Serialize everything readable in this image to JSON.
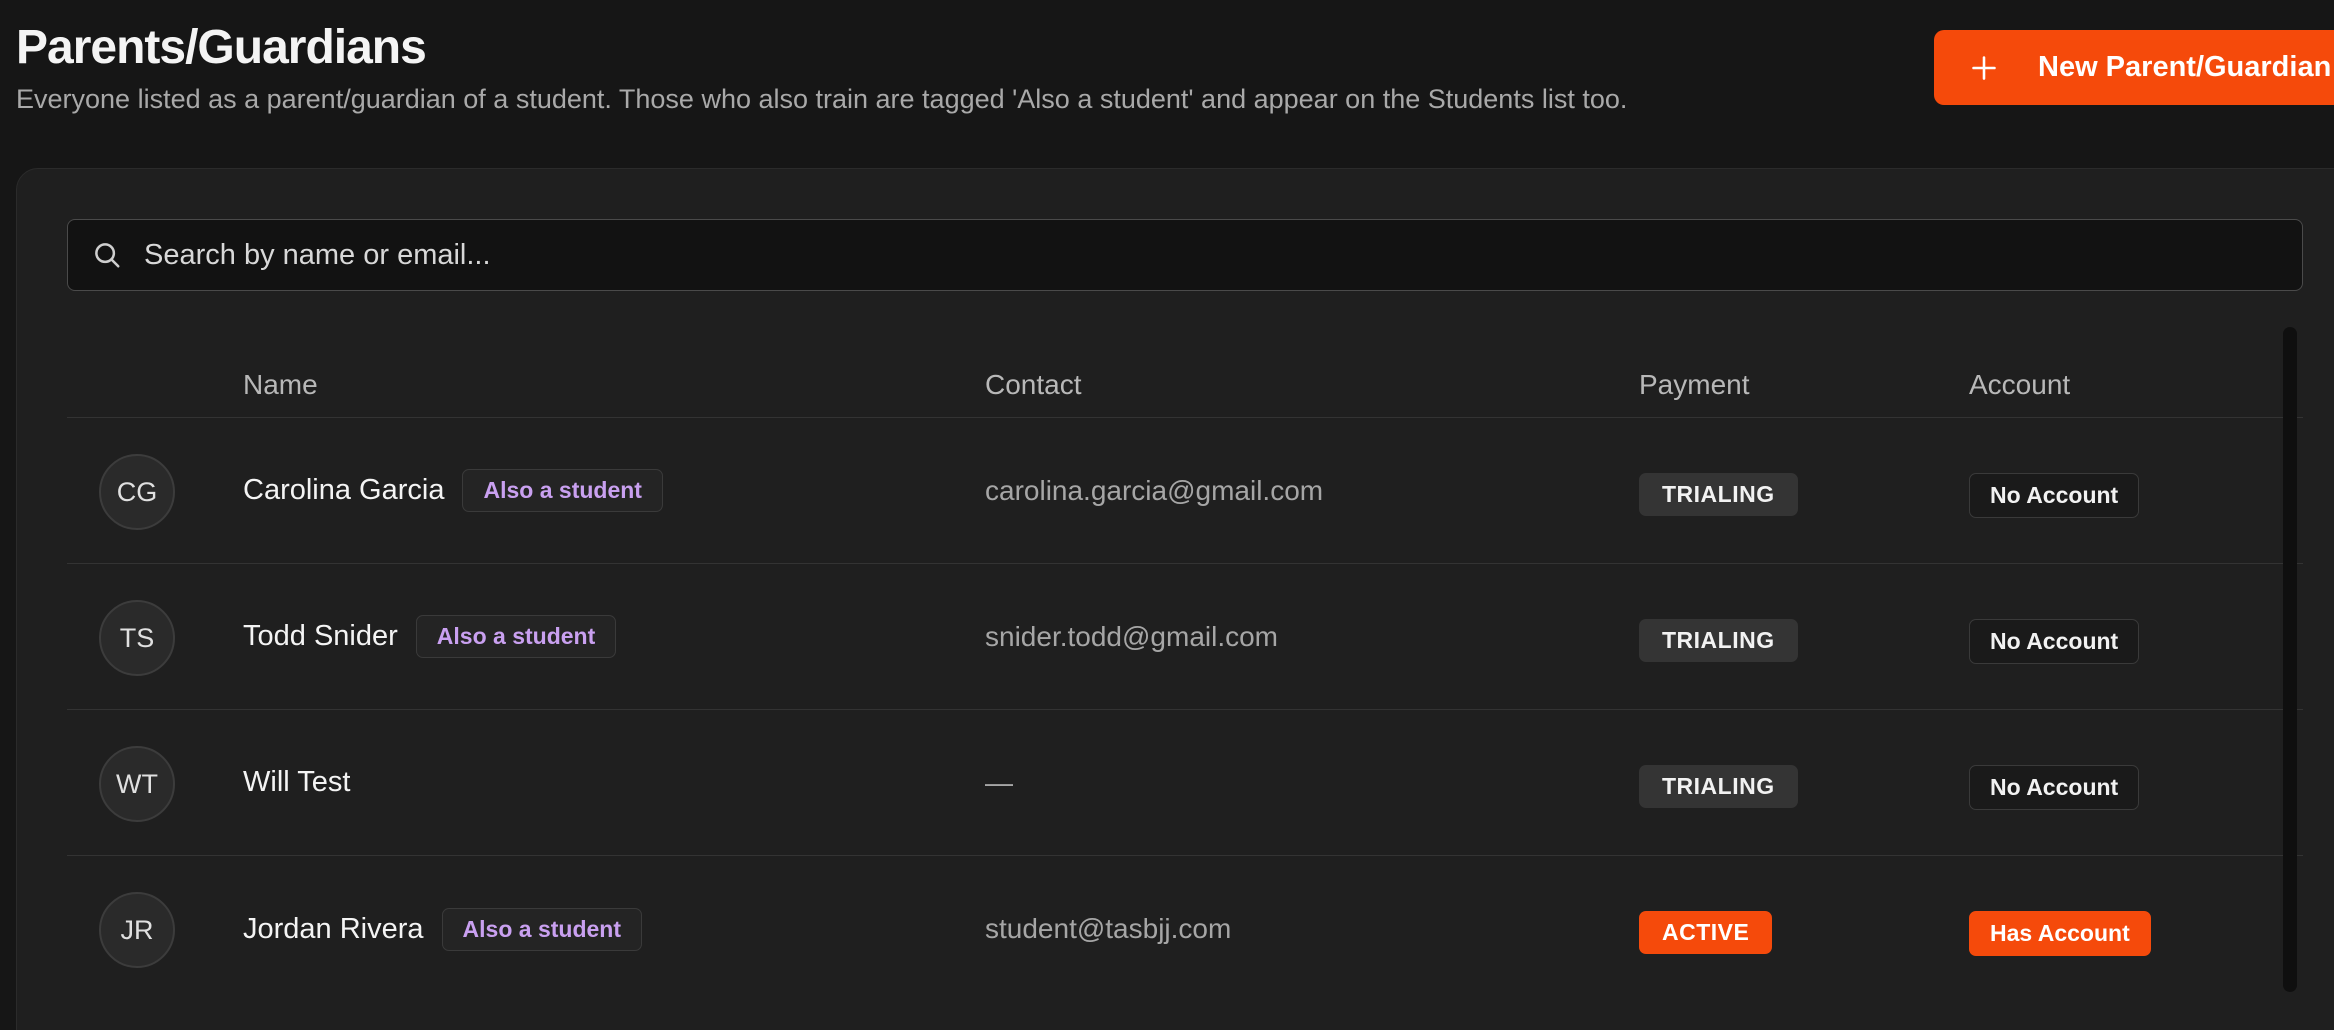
{
  "page": {
    "title": "Parents/Guardians",
    "subtitle": "Everyone listed as a parent/guardian of a student. Those who also train are tagged 'Also a student' and appear on the Students list too.",
    "new_button_label": "New Parent/Guardian",
    "new_button_icon": "plus-icon"
  },
  "colors": {
    "accent": "#f54a0b",
    "tag_text": "#c9a0f0",
    "background": "#161616",
    "card": "#1f1f1f"
  },
  "search": {
    "placeholder": "Search by name or email...",
    "value": "",
    "icon": "search-icon"
  },
  "table": {
    "headers": {
      "name": "Name",
      "contact": "Contact",
      "payment": "Payment",
      "account": "Account"
    },
    "rows": [
      {
        "initials": "CG",
        "name": "Carolina Garcia",
        "tag": "Also a student",
        "contact": "carolina.garcia@gmail.com",
        "payment": "TRIALING",
        "account": "No Account"
      },
      {
        "initials": "TS",
        "name": "Todd Snider",
        "tag": "Also a student",
        "contact": "snider.todd@gmail.com",
        "payment": "TRIALING",
        "account": "No Account"
      },
      {
        "initials": "WT",
        "name": "Will Test",
        "tag": "",
        "contact": "—",
        "payment": "TRIALING",
        "account": "No Account"
      },
      {
        "initials": "JR",
        "name": "Jordan Rivera",
        "tag": "Also a student",
        "contact": "student@tasbjj.com",
        "payment": "ACTIVE",
        "account": "Has Account"
      }
    ]
  }
}
